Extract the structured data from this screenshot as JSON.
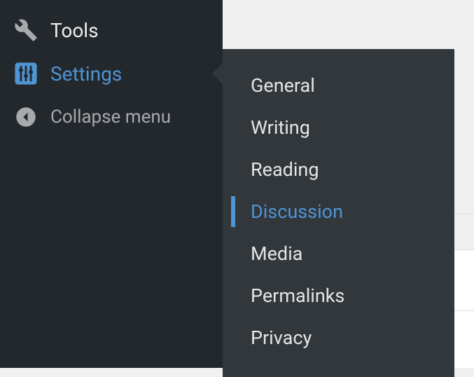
{
  "colors": {
    "accent": "#4f94d4",
    "sidebar_bg": "#23282d",
    "flyout_bg": "#32373c"
  },
  "sidebar": {
    "items": [
      {
        "label": "Tools",
        "icon": "wrench"
      },
      {
        "label": "Settings",
        "icon": "sliders",
        "current": true
      },
      {
        "label": "Collapse menu",
        "icon": "collapse"
      }
    ]
  },
  "settings_submenu": {
    "items": [
      {
        "label": "General"
      },
      {
        "label": "Writing"
      },
      {
        "label": "Reading"
      },
      {
        "label": "Discussion",
        "active": true
      },
      {
        "label": "Media"
      },
      {
        "label": "Permalinks"
      },
      {
        "label": "Privacy"
      }
    ]
  }
}
